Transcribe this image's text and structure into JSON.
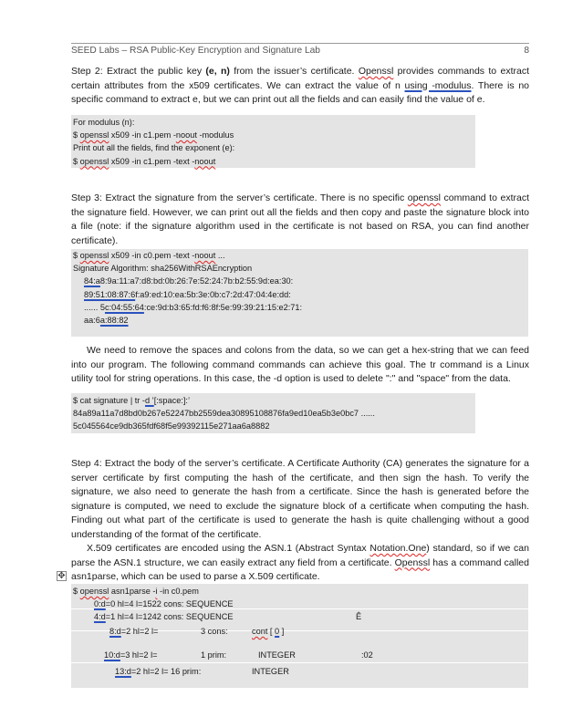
{
  "header": {
    "title": "SEED Labs – RSA Public-Key Encryption and Signature Lab",
    "page_number": "8"
  },
  "step2": {
    "pre": "Step 2: Extract the public key ",
    "bold": "(e, n)",
    "mid1": " from the issuer’s certificate. ",
    "openssl": "Openssl",
    "mid2": " provides commands to extract certain attributes from the x509 certificates. We can extract the value of n ",
    "using_modulus": "using -modulus",
    "post": ". There is no specific command to extract e, but we can print out all the fields and can easily find the value of e."
  },
  "modulus_block": {
    "line1": "For modulus (n):",
    "line2_prefix": "$ ",
    "line2_openssl": "openssl",
    "line2_mid": " x509 -in c1.pem -",
    "line2_noout": "noout",
    "line2_suffix": " -modulus",
    "line3": "Print out all the fields, find the exponent (e):",
    "line4_prefix": "$ ",
    "line4_openssl": "openssl",
    "line4_mid": " x509 -in c1.pem -text -",
    "line4_noout": "noout"
  },
  "step3": {
    "pre": "Step 3: Extract the signature from the server’s certificate. There is no specific ",
    "openssl": "openssl",
    "post": " command to extract the signature field. However, we can print out all the fields and then copy and paste the signature block into a file (note: if the signature algorithm used in the certificate is not based on RSA, you can find another certificate)."
  },
  "signature_block": {
    "cmd_prefix": "$ ",
    "cmd_openssl": "openssl",
    "cmd_mid": " x509 -in c0.pem -text -",
    "cmd_noout": "noout",
    "cmd_suffix": " ...",
    "algorithm": "Signature Algorithm: sha256WithRSAEncryption",
    "hex1_u": "84:a",
    "hex1_rest": "8:9a:11:a7:d8:bd:0b:26:7e:52:24:7b:b2:55:9d:ea:30:",
    "hex2_u": "89:51:08:87:6",
    "hex2_rest": "f:a9:ed:10:ea:5b:3e:0b:c7:2d:47:04:4e:dd:",
    "hex3_pre": "...... 5",
    "hex3_u": "c:04:55:64",
    "hex3_rest": ":ce:9d:b3:65:fd:f6:8f:5e:99:39:21:15:e2:71:",
    "hex4_pre": "aa:6",
    "hex4_u": "a:88:82"
  },
  "tr_paragraph": "We need to remove the spaces and colons from the data, so we can get a hex-string that we can feed into our program. The following command commands can achieve this goal. The tr command is a Linux utility tool for string operations. In this case, the -d option is used to delete \":\" and \"space\" from the data.",
  "tr_block": {
    "cmd_pre": "$ cat signature | tr -",
    "cmd_u": "d ’",
    "cmd_post": "[:space:]:’",
    "hex_line1": "84a89a11a7d8bd0b267e52247bb2559dea30895108876fa9ed10ea5b3e0bc7 ......",
    "hex_line2": "5c045564ce9db365fdf68f5e99392115e271aa6a8882"
  },
  "step4": "Step 4: Extract the body of the server’s certificate. A Certificate Authority (CA) generates the signature for a server certificate by first computing the hash of the certificate, and then sign the hash. To verify the signature, we also need to generate the hash from a certificate. Since the hash is generated before the signature is computed, we need to exclude the signature block of a certificate when computing the hash. Finding out what part of the certificate is used to generate the hash is quite challenging without a good understanding of the format of the certificate.",
  "x509_paragraph": {
    "pre": "X.509 certificates are encoded using the ASN.1 (Abstract Syntax ",
    "notation": "Notation.One",
    "mid": ") standard, so if we can parse the ASN.1 structure, we can easily extract any field from a certificate. ",
    "openssl": "Openssl",
    "post": " has a command called asn1parse, which can be used to parse a X.509 certificate."
  },
  "asn1_block": {
    "cmd_prefix": "$ ",
    "cmd_openssl": "openssl",
    "cmd_mid": " asn1parse -",
    "cmd_i": "i",
    "cmd_suffix": " -in c0.pem",
    "rows": [
      {
        "offset": "0:d",
        "rest": "=0 hl=4 l=1522 cons: SEQUENCE",
        "extra": ""
      },
      {
        "offset": "4:d",
        "rest": "=1 hl=4 l=1242 cons: SEQUENCE",
        "extra": "Ê"
      },
      {
        "offset": "8:d",
        "rest": "=2 hl=2 l=",
        "len": "3 cons:",
        "type_sq": "cont",
        "type_rest": " [ ",
        "type_u": "0",
        "type_end": " ]"
      },
      {
        "offset": "10:d",
        "rest": "=3 hl=2 l=",
        "len": "1 prim:",
        "type": "INTEGER",
        "value": ":02"
      },
      {
        "offset": "13:d",
        "rest": "=2 hl=2 l= 16 prim:",
        "type": "INTEGER"
      }
    ]
  }
}
